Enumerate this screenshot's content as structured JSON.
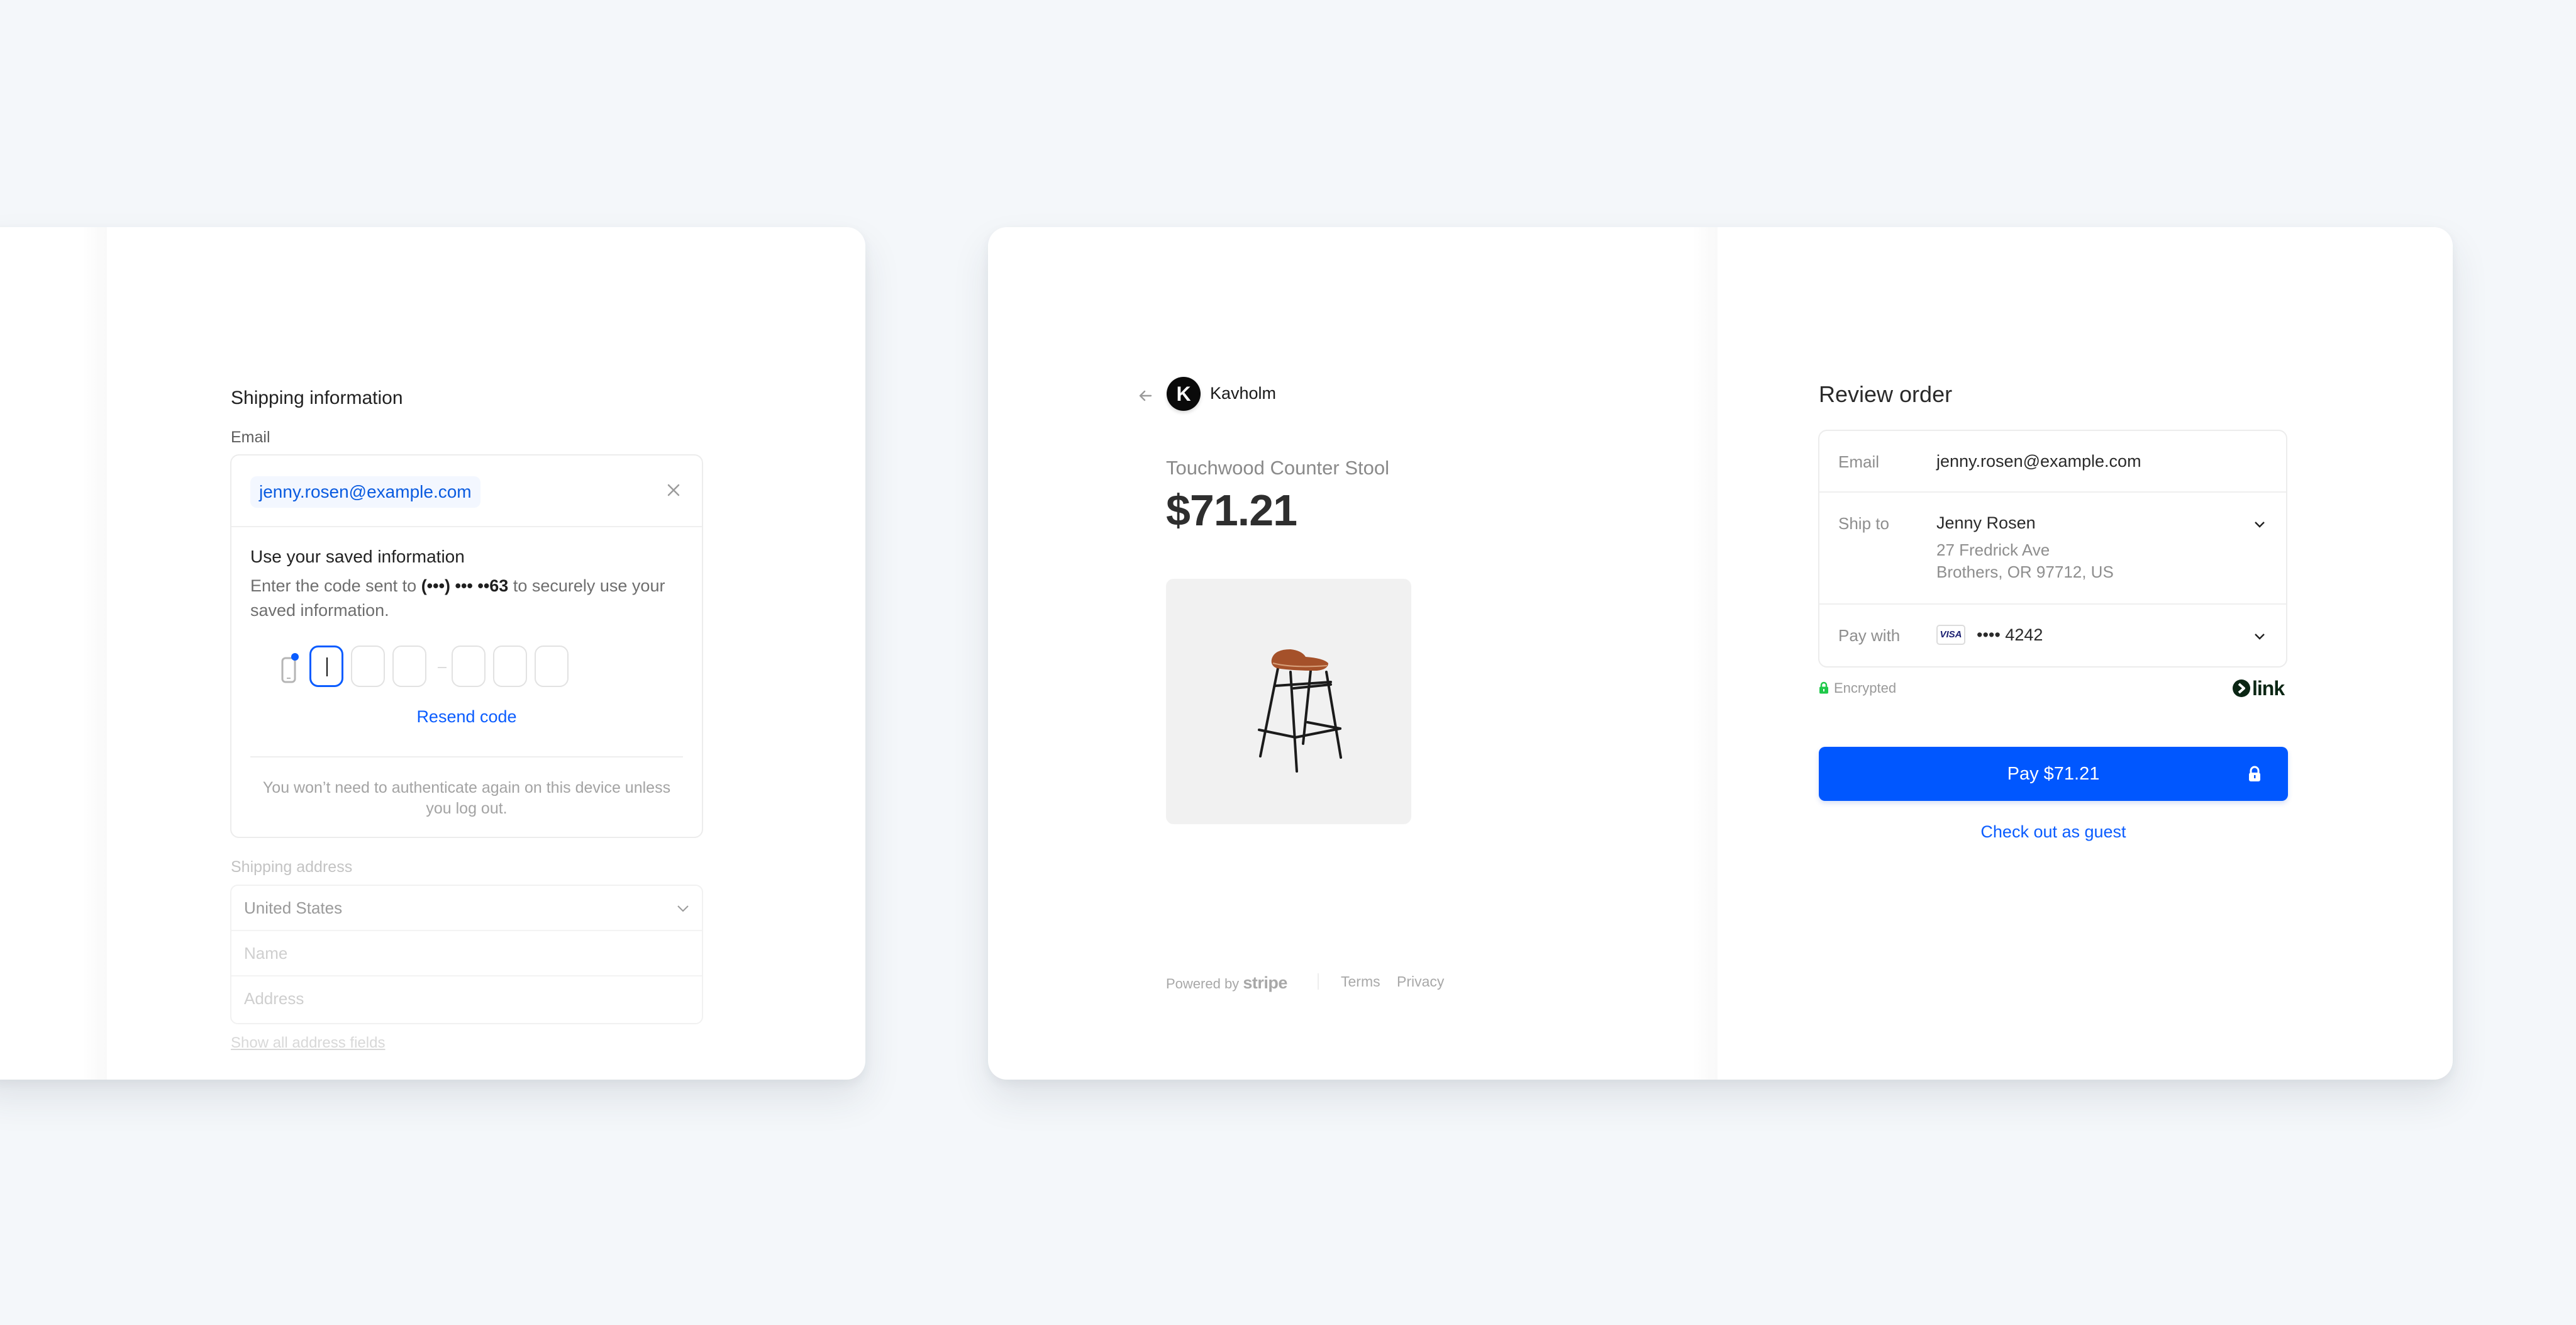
{
  "left_panel": {
    "title": "Shipping information",
    "email_label": "Email",
    "email_value": "jenny.rosen@example.com",
    "saved_info": {
      "title": "Use your saved information",
      "desc_before": "Enter the code sent to ",
      "masked_phone": "(•••) ••• ••63",
      "desc_after": " to securely use your saved information.",
      "otp_digits": [
        "",
        "",
        "",
        "",
        "",
        ""
      ],
      "resend_label": "Resend code",
      "note": "You won’t need to authenticate again on this device unless you log out."
    },
    "shipping_address_label": "Shipping address",
    "country_value": "United States",
    "name_placeholder": "Name",
    "address_placeholder": "Address",
    "show_all_label": "Show all address fields"
  },
  "right_panel": {
    "merchant": {
      "logo_letter": "K",
      "name": "Kavholm"
    },
    "product": {
      "name": "Touchwood Counter Stool",
      "price": "$71.21"
    },
    "footer": {
      "powered_by": "Powered by",
      "brand": "stripe",
      "terms": "Terms",
      "privacy": "Privacy"
    },
    "review": {
      "title": "Review order",
      "email_label": "Email",
      "email_value": "jenny.rosen@example.com",
      "ship_to_label": "Ship to",
      "ship_name": "Jenny Rosen",
      "ship_line1": "27 Fredrick Ave",
      "ship_line2": "Brothers, OR 97712, US",
      "pay_with_label": "Pay with",
      "card_brand": "VISA",
      "card_masked": "•••• 4242",
      "encrypted_label": "Encrypted",
      "link_brand": "link",
      "pay_button": "Pay $71.21",
      "guest_link": "Check out as guest"
    }
  },
  "colors": {
    "accent": "#0057ff",
    "link_blue": "#0a5cff",
    "background": "#f4f7fa",
    "encrypted_green": "#1fc94a",
    "visa_navy": "#1a1f71"
  }
}
